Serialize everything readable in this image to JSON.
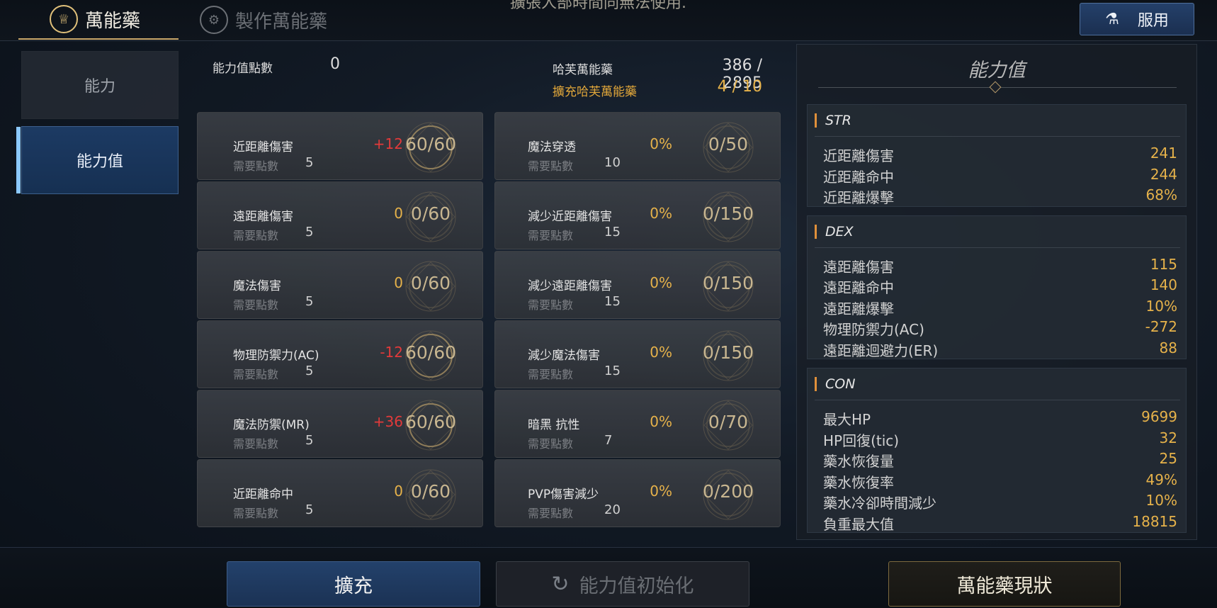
{
  "top_tabs": [
    {
      "label": "萬能藥",
      "icon": "potion-emblem-icon"
    },
    {
      "label": "製作萬能藥",
      "icon": "craft-gear-icon"
    }
  ],
  "notice_text": "擴張人部時間同無法使用.",
  "use_button": {
    "label": "服用",
    "icon": "flask-icon"
  },
  "side_menu": [
    "能力",
    "能力值"
  ],
  "ability_points": {
    "label": "能力值點數",
    "value": "0"
  },
  "elixir": {
    "label": "哈芙萬能藥",
    "value": "386 / 2895"
  },
  "expand_elixir": {
    "label": "擴充哈芙萬能藥",
    "value": "4 / 10"
  },
  "required_label": "需要點數",
  "cards_left": [
    {
      "name": "近距離傷害",
      "req": "5",
      "bonus": "+12",
      "bonus_color": "red",
      "progress": "60/60",
      "fill": 1.0
    },
    {
      "name": "遠距離傷害",
      "req": "5",
      "bonus": "0",
      "bonus_color": "gold",
      "progress": "0/60",
      "fill": 0.0
    },
    {
      "name": "魔法傷害",
      "req": "5",
      "bonus": "0",
      "bonus_color": "gold",
      "progress": "0/60",
      "fill": 0.0
    },
    {
      "name": "物理防禦力(AC)",
      "req": "5",
      "bonus": "-12",
      "bonus_color": "red",
      "progress": "60/60",
      "fill": 1.0
    },
    {
      "name": "魔法防禦(MR)",
      "req": "5",
      "bonus": "+36",
      "bonus_color": "red",
      "progress": "60/60",
      "fill": 1.0
    },
    {
      "name": "近距離命中",
      "req": "5",
      "bonus": "0",
      "bonus_color": "gold",
      "progress": "0/60",
      "fill": 0.0
    }
  ],
  "cards_right": [
    {
      "name": "魔法穿透",
      "req": "10",
      "bonus": "0%",
      "bonus_color": "gold",
      "progress": "0/50",
      "fill": 0.0
    },
    {
      "name": "減少近距離傷害",
      "req": "15",
      "bonus": "0%",
      "bonus_color": "gold",
      "progress": "0/150",
      "fill": 0.0
    },
    {
      "name": "減少遠距離傷害",
      "req": "15",
      "bonus": "0%",
      "bonus_color": "gold",
      "progress": "0/150",
      "fill": 0.0
    },
    {
      "name": "減少魔法傷害",
      "req": "15",
      "bonus": "0%",
      "bonus_color": "gold",
      "progress": "0/150",
      "fill": 0.0
    },
    {
      "name": "暗黑 抗性",
      "req": "7",
      "bonus": "0%",
      "bonus_color": "gold",
      "progress": "0/70",
      "fill": 0.0
    },
    {
      "name": "PVP傷害減少",
      "req": "20",
      "bonus": "0%",
      "bonus_color": "gold",
      "progress": "0/200",
      "fill": 0.0
    }
  ],
  "stats_panel": {
    "title": "能力值",
    "groups": [
      {
        "name": "STR",
        "rows": [
          {
            "label": "近距離傷害",
            "value": "241"
          },
          {
            "label": "近距離命中",
            "value": "244"
          },
          {
            "label": "近距離爆擊",
            "value": "68%"
          }
        ]
      },
      {
        "name": "DEX",
        "rows": [
          {
            "label": "遠距離傷害",
            "value": "115"
          },
          {
            "label": "遠距離命中",
            "value": "140"
          },
          {
            "label": "遠距離爆擊",
            "value": "10%"
          },
          {
            "label": "物理防禦力(AC)",
            "value": "-272"
          },
          {
            "label": "遠距離迴避力(ER)",
            "value": "88"
          }
        ]
      },
      {
        "name": "CON",
        "rows": [
          {
            "label": "最大HP",
            "value": "9699"
          },
          {
            "label": "HP回復(tic)",
            "value": "32"
          },
          {
            "label": "藥水恢復量",
            "value": "25"
          },
          {
            "label": "藥水恢復率",
            "value": "49%"
          },
          {
            "label": "藥水冷卻時間減少",
            "value": "10%"
          },
          {
            "label": "負重最大值",
            "value": "18815"
          }
        ]
      }
    ]
  },
  "buttons": {
    "expand": "擴充",
    "reset": "能力值初始化",
    "status": "萬能藥現狀"
  },
  "colors": {
    "accent_gold": "#e6b24a",
    "bonus_red": "#e23a3a",
    "button_blue": "#23416b"
  }
}
